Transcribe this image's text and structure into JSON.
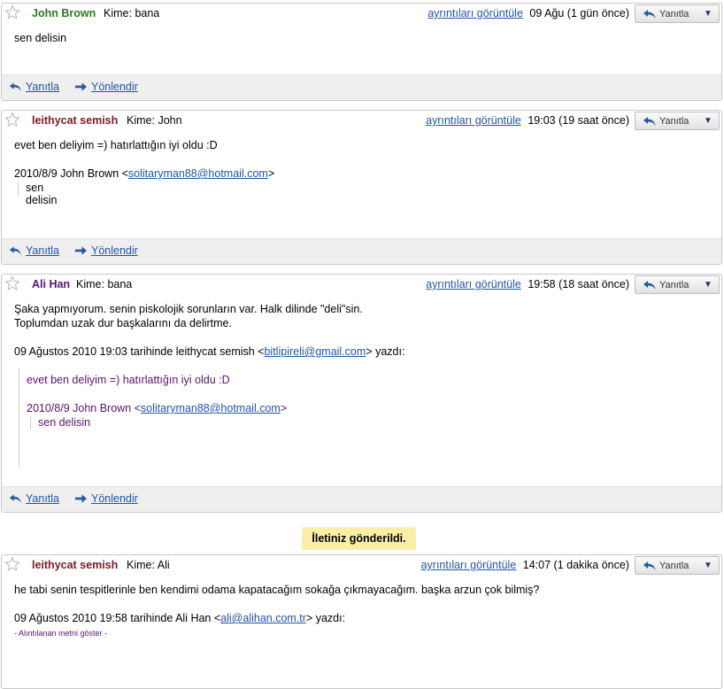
{
  "common": {
    "details_link": "ayrıntıları görüntüle",
    "reply_button": "Yanıtla",
    "menu_arrow": "▼",
    "footer_reply": "Yanıtla",
    "footer_forward": "Yönlendir",
    "to_prefix": "Kime:"
  },
  "messages": [
    {
      "sender": "John Brown",
      "sender_color": "#2a7a1c",
      "to": "bana",
      "time": "09 Ağu (1 gün önce)",
      "body": "sen delisin"
    },
    {
      "sender": "leithycat semish",
      "sender_color": "#7a1b25",
      "to": "John",
      "time": "19:03 (19 saat önce)",
      "body": "evet ben deliyim =) hatırlattığın iyi oldu :D",
      "quote_header_pre": "2010/8/9 John Brown <",
      "quote_email": "solitaryman88@hotmail.com",
      "quote_header_post": ">",
      "quote_text": "sen delisin"
    },
    {
      "sender": "Ali Han",
      "sender_color": "#5a1270",
      "to": "bana",
      "time": "19:58 (18 saat önce)",
      "body_line1": "Şaka yapmıyorum. senin piskolojik sorunların var. Halk dilinde \"deli\"sin.",
      "body_line2": "Toplumdan uzak dur başkalarını da delirtme.",
      "quote_header_pre": "09 Ağustos 2010 19:03 tarihinde leithycat semish <",
      "quote_email": "bitlipireli@gmail.com",
      "quote_header_post": "> yazdı:",
      "nested_text": "evet ben deliyim =) hatırlattığın iyi oldu :D",
      "nested_header_pre": "2010/8/9 John Brown <",
      "nested_email": "solitaryman88@hotmail.com",
      "nested_header_post": ">",
      "nested_quote": "sen delisin"
    },
    {
      "sender": "leithycat semish",
      "sender_color": "#7a1b25",
      "to": "Ali",
      "time": "14:07 (1 dakika önce)",
      "body": "he tabi senin tespitlerinle ben kendimi odama kapatacağım sokağa çıkmayacağım. başka arzun çok bilmiş?",
      "quote_header_pre": "09 Ağustos 2010 19:58 tarihinde Ali Han <",
      "quote_email": "ali@alihan.com.tr",
      "quote_header_post": "> yazdı:",
      "show_quoted": "- Alıntılanan metni göster -"
    }
  ],
  "notice": "İletiniz gönderildi."
}
